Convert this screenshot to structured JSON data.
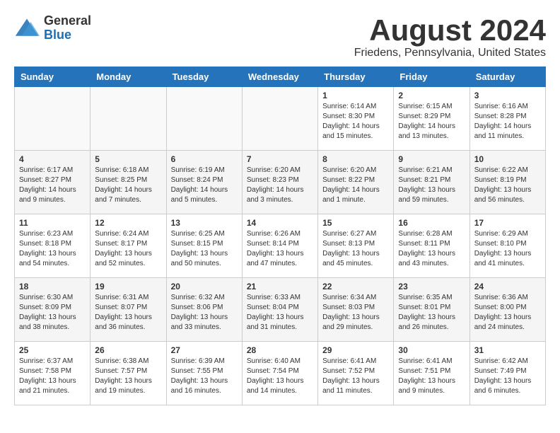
{
  "header": {
    "logo_general": "General",
    "logo_blue": "Blue",
    "month_title": "August 2024",
    "location": "Friedens, Pennsylvania, United States"
  },
  "days_of_week": [
    "Sunday",
    "Monday",
    "Tuesday",
    "Wednesday",
    "Thursday",
    "Friday",
    "Saturday"
  ],
  "weeks": [
    [
      {
        "day": "",
        "content": ""
      },
      {
        "day": "",
        "content": ""
      },
      {
        "day": "",
        "content": ""
      },
      {
        "day": "",
        "content": ""
      },
      {
        "day": "1",
        "content": "Sunrise: 6:14 AM\nSunset: 8:30 PM\nDaylight: 14 hours\nand 15 minutes."
      },
      {
        "day": "2",
        "content": "Sunrise: 6:15 AM\nSunset: 8:29 PM\nDaylight: 14 hours\nand 13 minutes."
      },
      {
        "day": "3",
        "content": "Sunrise: 6:16 AM\nSunset: 8:28 PM\nDaylight: 14 hours\nand 11 minutes."
      }
    ],
    [
      {
        "day": "4",
        "content": "Sunrise: 6:17 AM\nSunset: 8:27 PM\nDaylight: 14 hours\nand 9 minutes."
      },
      {
        "day": "5",
        "content": "Sunrise: 6:18 AM\nSunset: 8:25 PM\nDaylight: 14 hours\nand 7 minutes."
      },
      {
        "day": "6",
        "content": "Sunrise: 6:19 AM\nSunset: 8:24 PM\nDaylight: 14 hours\nand 5 minutes."
      },
      {
        "day": "7",
        "content": "Sunrise: 6:20 AM\nSunset: 8:23 PM\nDaylight: 14 hours\nand 3 minutes."
      },
      {
        "day": "8",
        "content": "Sunrise: 6:20 AM\nSunset: 8:22 PM\nDaylight: 14 hours\nand 1 minute."
      },
      {
        "day": "9",
        "content": "Sunrise: 6:21 AM\nSunset: 8:21 PM\nDaylight: 13 hours\nand 59 minutes."
      },
      {
        "day": "10",
        "content": "Sunrise: 6:22 AM\nSunset: 8:19 PM\nDaylight: 13 hours\nand 56 minutes."
      }
    ],
    [
      {
        "day": "11",
        "content": "Sunrise: 6:23 AM\nSunset: 8:18 PM\nDaylight: 13 hours\nand 54 minutes."
      },
      {
        "day": "12",
        "content": "Sunrise: 6:24 AM\nSunset: 8:17 PM\nDaylight: 13 hours\nand 52 minutes."
      },
      {
        "day": "13",
        "content": "Sunrise: 6:25 AM\nSunset: 8:15 PM\nDaylight: 13 hours\nand 50 minutes."
      },
      {
        "day": "14",
        "content": "Sunrise: 6:26 AM\nSunset: 8:14 PM\nDaylight: 13 hours\nand 47 minutes."
      },
      {
        "day": "15",
        "content": "Sunrise: 6:27 AM\nSunset: 8:13 PM\nDaylight: 13 hours\nand 45 minutes."
      },
      {
        "day": "16",
        "content": "Sunrise: 6:28 AM\nSunset: 8:11 PM\nDaylight: 13 hours\nand 43 minutes."
      },
      {
        "day": "17",
        "content": "Sunrise: 6:29 AM\nSunset: 8:10 PM\nDaylight: 13 hours\nand 41 minutes."
      }
    ],
    [
      {
        "day": "18",
        "content": "Sunrise: 6:30 AM\nSunset: 8:09 PM\nDaylight: 13 hours\nand 38 minutes."
      },
      {
        "day": "19",
        "content": "Sunrise: 6:31 AM\nSunset: 8:07 PM\nDaylight: 13 hours\nand 36 minutes."
      },
      {
        "day": "20",
        "content": "Sunrise: 6:32 AM\nSunset: 8:06 PM\nDaylight: 13 hours\nand 33 minutes."
      },
      {
        "day": "21",
        "content": "Sunrise: 6:33 AM\nSunset: 8:04 PM\nDaylight: 13 hours\nand 31 minutes."
      },
      {
        "day": "22",
        "content": "Sunrise: 6:34 AM\nSunset: 8:03 PM\nDaylight: 13 hours\nand 29 minutes."
      },
      {
        "day": "23",
        "content": "Sunrise: 6:35 AM\nSunset: 8:01 PM\nDaylight: 13 hours\nand 26 minutes."
      },
      {
        "day": "24",
        "content": "Sunrise: 6:36 AM\nSunset: 8:00 PM\nDaylight: 13 hours\nand 24 minutes."
      }
    ],
    [
      {
        "day": "25",
        "content": "Sunrise: 6:37 AM\nSunset: 7:58 PM\nDaylight: 13 hours\nand 21 minutes."
      },
      {
        "day": "26",
        "content": "Sunrise: 6:38 AM\nSunset: 7:57 PM\nDaylight: 13 hours\nand 19 minutes."
      },
      {
        "day": "27",
        "content": "Sunrise: 6:39 AM\nSunset: 7:55 PM\nDaylight: 13 hours\nand 16 minutes."
      },
      {
        "day": "28",
        "content": "Sunrise: 6:40 AM\nSunset: 7:54 PM\nDaylight: 13 hours\nand 14 minutes."
      },
      {
        "day": "29",
        "content": "Sunrise: 6:41 AM\nSunset: 7:52 PM\nDaylight: 13 hours\nand 11 minutes."
      },
      {
        "day": "30",
        "content": "Sunrise: 6:41 AM\nSunset: 7:51 PM\nDaylight: 13 hours\nand 9 minutes."
      },
      {
        "day": "31",
        "content": "Sunrise: 6:42 AM\nSunset: 7:49 PM\nDaylight: 13 hours\nand 6 minutes."
      }
    ]
  ]
}
